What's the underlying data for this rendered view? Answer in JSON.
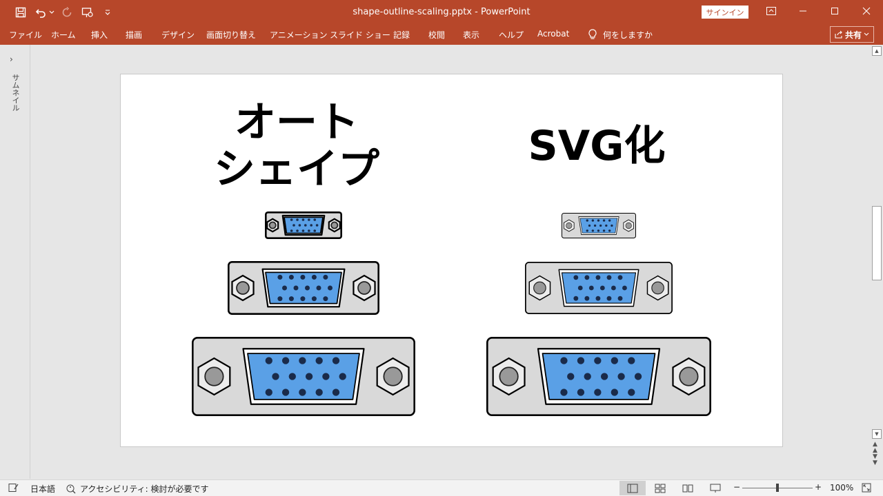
{
  "titlebar": {
    "document_title": "shape-outline-scaling.pptx  -  PowerPoint",
    "signin_label": "サインイン",
    "quick_access": [
      "save-icon",
      "undo-icon",
      "redo-icon",
      "present-from-start-icon",
      "customize-qat-icon"
    ],
    "window_controls": [
      "ribbon-display-options-icon",
      "minimize-icon",
      "maximize-icon",
      "close-icon"
    ]
  },
  "ribbon": {
    "tabs": [
      "ファイル",
      "ホーム",
      "挿入",
      "描画",
      "デザイン",
      "画面切り替え",
      "アニメーション",
      "スライド ショー",
      "記録",
      "校閲",
      "表示",
      "ヘルプ",
      "Acrobat"
    ],
    "tell_me": "何をしますか",
    "share_label": "共有"
  },
  "thumbnail_pane": {
    "label": "サムネイル",
    "expand": "›"
  },
  "slide": {
    "heading_left": [
      "オート",
      "シェイプ"
    ],
    "heading_right": "SVG化",
    "connector_sizes": [
      "small",
      "medium",
      "large"
    ]
  },
  "statusbar": {
    "language": "日本語",
    "accessibility": "アクセシビリティ: 検討が必要です",
    "zoom": "100%",
    "zoom_minus": "−",
    "zoom_plus": "+"
  },
  "colors": {
    "accent": "#b7472a",
    "connector_body": "#d9d9d9",
    "connector_port": "#5aa0e6"
  }
}
